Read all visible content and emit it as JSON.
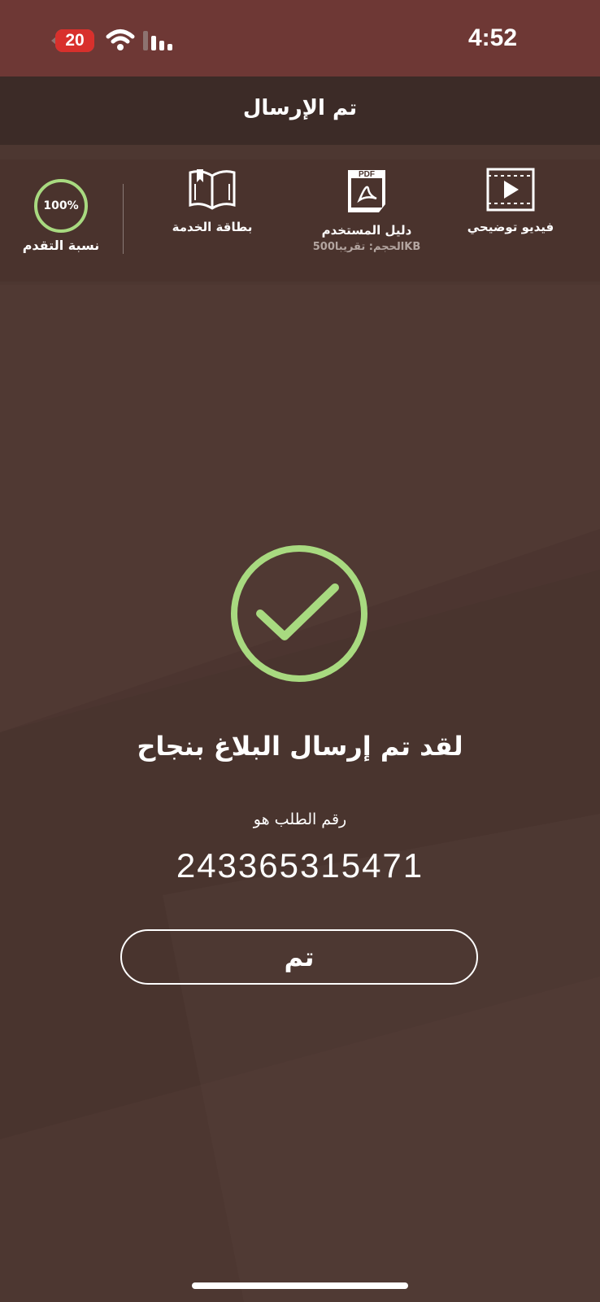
{
  "status_bar": {
    "time": "4:52",
    "battery_level": "20",
    "wifi_icon": "wifi-icon",
    "signal_icon": "cellular-signal-icon"
  },
  "header": {
    "title": "تم الإرسال"
  },
  "tools": {
    "video": {
      "label": "فيديو توضيحي",
      "icon": "video-play-icon"
    },
    "guide": {
      "label": "دليل المستخدم",
      "size": "الحجم: تقريبا500KB",
      "icon": "pdf-file-icon",
      "icon_text": "PDF"
    },
    "service_card": {
      "label": "بطاقة الخدمة",
      "icon": "open-book-icon"
    },
    "progress": {
      "value": "100%",
      "label": "نسبة التقدم"
    }
  },
  "result": {
    "icon": "success-check-icon",
    "message": "لقد تم إرسال البلاغ بنجاح",
    "order_label": "رقم الطلب هو",
    "order_number": "243365315471",
    "done_label": "تم"
  },
  "colors": {
    "status_bar_bg": "#6e3835",
    "header_bg": "#3c2b27",
    "page_bg": "#4d3731",
    "success_green": "#a8da80",
    "battery_red": "#d8302c"
  }
}
